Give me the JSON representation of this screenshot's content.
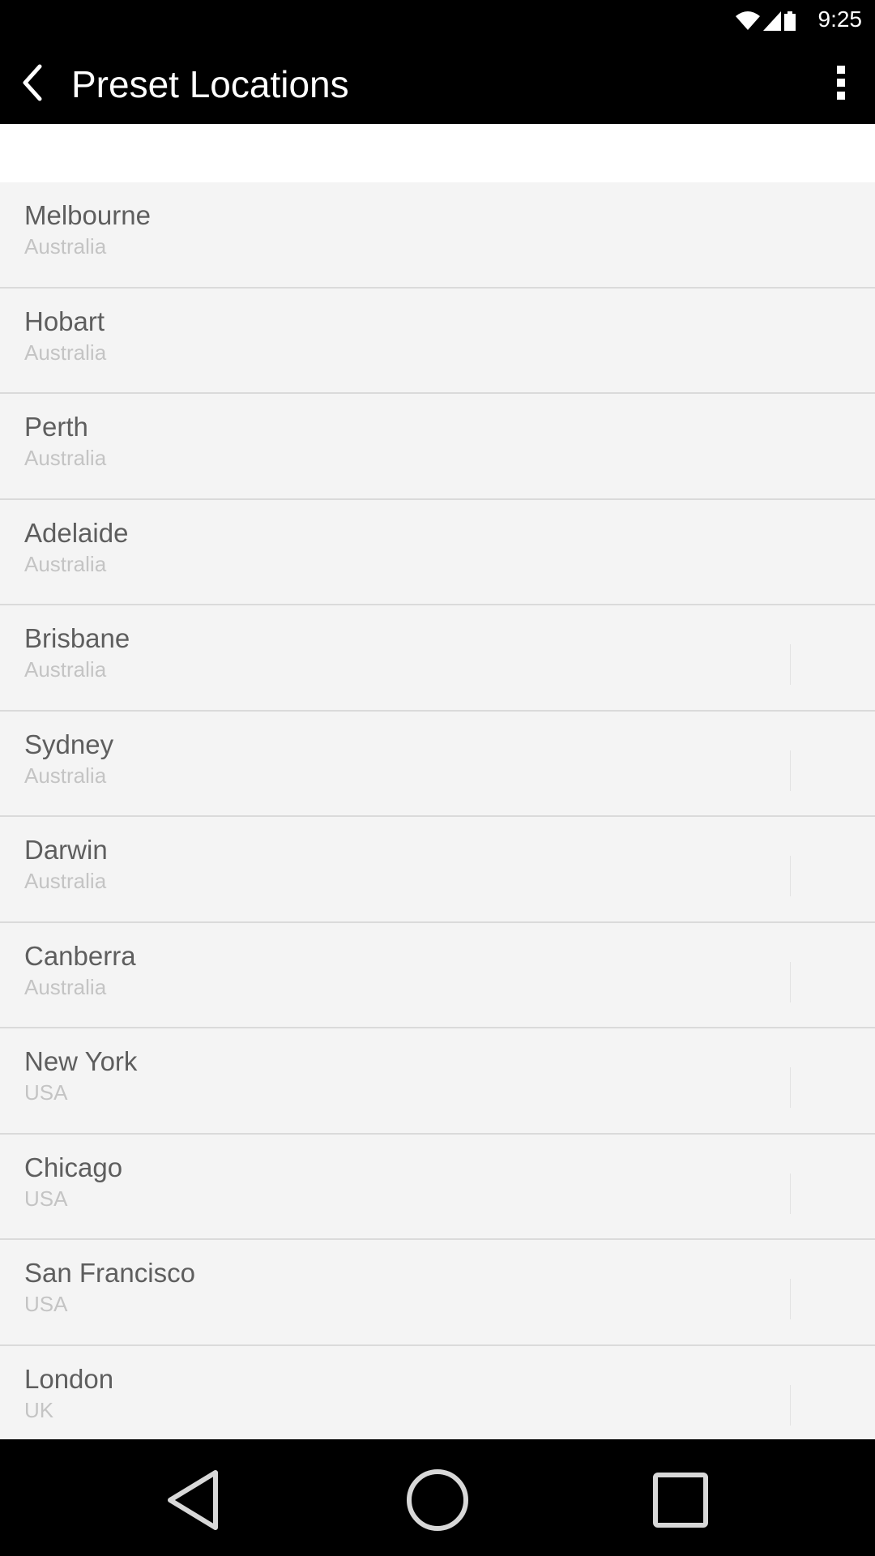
{
  "status_bar": {
    "time": "9:25",
    "icons": [
      "wifi-icon",
      "cell-signal-icon",
      "battery-icon"
    ]
  },
  "app_bar": {
    "title": "Preset Locations",
    "back_icon": "chevron-left-icon",
    "menu_icon": "more-vert-icon"
  },
  "locations": [
    {
      "city": "Melbourne",
      "country": "Australia"
    },
    {
      "city": "Hobart",
      "country": "Australia"
    },
    {
      "city": "Perth",
      "country": "Australia"
    },
    {
      "city": "Adelaide",
      "country": "Australia"
    },
    {
      "city": "Brisbane",
      "country": "Australia"
    },
    {
      "city": "Sydney",
      "country": "Australia"
    },
    {
      "city": "Darwin",
      "country": "Australia"
    },
    {
      "city": "Canberra",
      "country": "Australia"
    },
    {
      "city": "New York",
      "country": "USA"
    },
    {
      "city": "Chicago",
      "country": "USA"
    },
    {
      "city": "San Francisco",
      "country": "USA"
    },
    {
      "city": "London",
      "country": "UK"
    }
  ],
  "nav_bar": {
    "icons": [
      "nav-back-icon",
      "nav-home-icon",
      "nav-recents-icon"
    ]
  },
  "colors": {
    "bar_background": "#000000",
    "list_background": "#f4f4f4",
    "divider": "#dadada",
    "city_text": "#5e5e5e",
    "country_text": "#c4c4c4"
  }
}
